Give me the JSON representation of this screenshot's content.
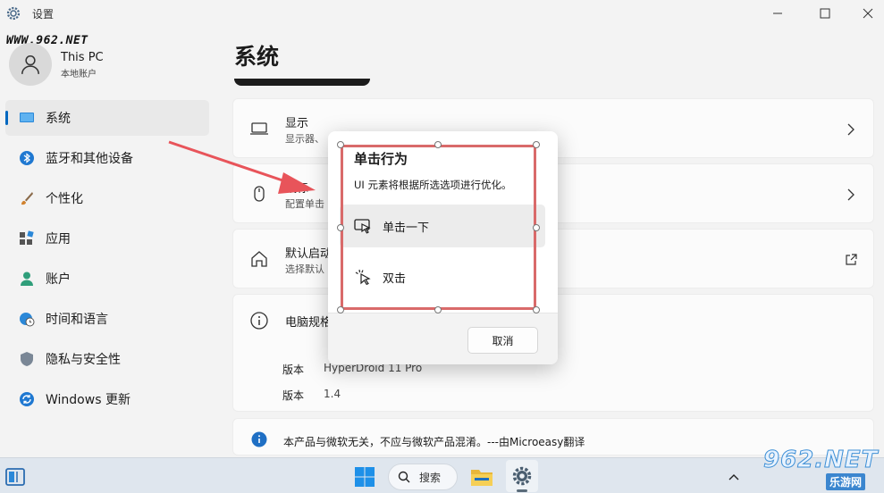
{
  "window": {
    "title": "设置"
  },
  "watermark": {
    "top_text": "WWW.962.NET",
    "logo_text": "962.NET",
    "logo_sub": "乐游网"
  },
  "user": {
    "name": "This PC",
    "account_type": "本地账户"
  },
  "sidebar": {
    "items": [
      {
        "label": "系统",
        "icon": "monitor-icon",
        "active": true
      },
      {
        "label": "蓝牙和其他设备",
        "icon": "bluetooth-icon"
      },
      {
        "label": "个性化",
        "icon": "brush-icon"
      },
      {
        "label": "应用",
        "icon": "apps-icon"
      },
      {
        "label": "账户",
        "icon": "person-icon"
      },
      {
        "label": "时间和语言",
        "icon": "globe-clock-icon"
      },
      {
        "label": "隐私与安全性",
        "icon": "shield-icon"
      },
      {
        "label": "Windows 更新",
        "icon": "refresh-icon"
      }
    ]
  },
  "main": {
    "title": "系统",
    "cards": [
      {
        "title": "显示",
        "subtitle": "显示器、",
        "icon": "laptop-icon"
      },
      {
        "title": "鼠标",
        "subtitle": "配置单击",
        "icon": "mouse-icon"
      },
      {
        "title": "默认启动",
        "subtitle": "选择默认",
        "icon": "home-icon"
      },
      {
        "title": "电脑规格",
        "icon": "info-icon"
      }
    ],
    "specs": [
      {
        "label": "版本",
        "value": "HyperDroid 11 Pro"
      },
      {
        "label": "版本",
        "value": "1.4"
      }
    ],
    "notice": "本产品与微软无关，不应与微软产品混淆。---由Microeasy翻译"
  },
  "dialog": {
    "title": "单击行为",
    "description": "UI 元素将根据所选选项进行优化。",
    "options": [
      {
        "label": "单击一下",
        "icon": "single-click-icon",
        "selected": true
      },
      {
        "label": "双击",
        "icon": "double-click-icon",
        "selected": false
      }
    ],
    "cancel_label": "取消"
  },
  "taskbar": {
    "search_label": "搜索"
  },
  "colors": {
    "accent": "#0067c0",
    "annotation": "#d96a6a",
    "arrow": "#e8545a"
  }
}
